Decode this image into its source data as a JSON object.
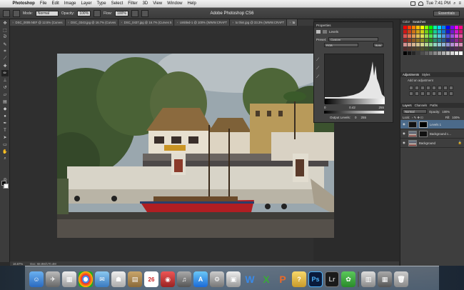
{
  "menubar": {
    "app": "Photoshop",
    "items": [
      "File",
      "Edit",
      "Image",
      "Layer",
      "Type",
      "Select",
      "Filter",
      "3D",
      "View",
      "Window",
      "Help"
    ],
    "clock": "Tue 7:41 PM"
  },
  "options": {
    "window_title": "Adobe Photoshop CS6",
    "mode_label": "Mode:",
    "mode_value": "Normal",
    "opacity_label": "Opacity:",
    "opacity_value": "100%",
    "flow_label": "Flow:",
    "flow_value": "100%",
    "workspace": "Essentials"
  },
  "tabs": [
    {
      "label": "DSC_0009.NEF @ 12.5% (Curves"
    },
    {
      "label": "DSC_0343.jpg @ 16.7% (Curves"
    },
    {
      "label": "DSC_0437.jpg @ 16.7% (Curves 5"
    },
    {
      "label": "Untitled-1 @ 100% (WWW.CRAFT"
    },
    {
      "label": "to this!.jpg @ 33.3% (WWW.CRAFT"
    },
    {
      "label": "to"
    }
  ],
  "status": {
    "zoom": "16.67%",
    "doc": "Doc: 68.8M/170.4M"
  },
  "properties": {
    "title": "Properties",
    "panel": "Levels",
    "preset_label": "Preset:",
    "preset_value": "Custom",
    "channel": "RGB",
    "auto_label": "Auto",
    "input_shadow": "0",
    "input_mid": "0.42",
    "input_high": "255",
    "output_label": "Output Levels:",
    "output_low": "0",
    "output_high": "255"
  },
  "right": {
    "color_tab": "Color",
    "swatches_tab": "Swatches",
    "adjust_tab": "Adjustments",
    "styles_tab": "Styles",
    "add_adjust": "Add an adjustment",
    "layers_tab": "Layers",
    "channels_tab": "Channels",
    "paths_tab": "Paths",
    "blend_mode": "Normal",
    "opacity_label": "Opacity:",
    "opacity_value": "100%",
    "lock_label": "Lock:",
    "fill_label": "Fill:",
    "fill_value": "100%",
    "layers": [
      {
        "name": "Levels 1",
        "active": true
      },
      {
        "name": "Background c...",
        "active": false
      },
      {
        "name": "Background",
        "active": false
      }
    ]
  },
  "colors": {
    "accent": "#4b6a8a",
    "panel": "#3e3e3e",
    "boat_red": "#b01e22"
  }
}
